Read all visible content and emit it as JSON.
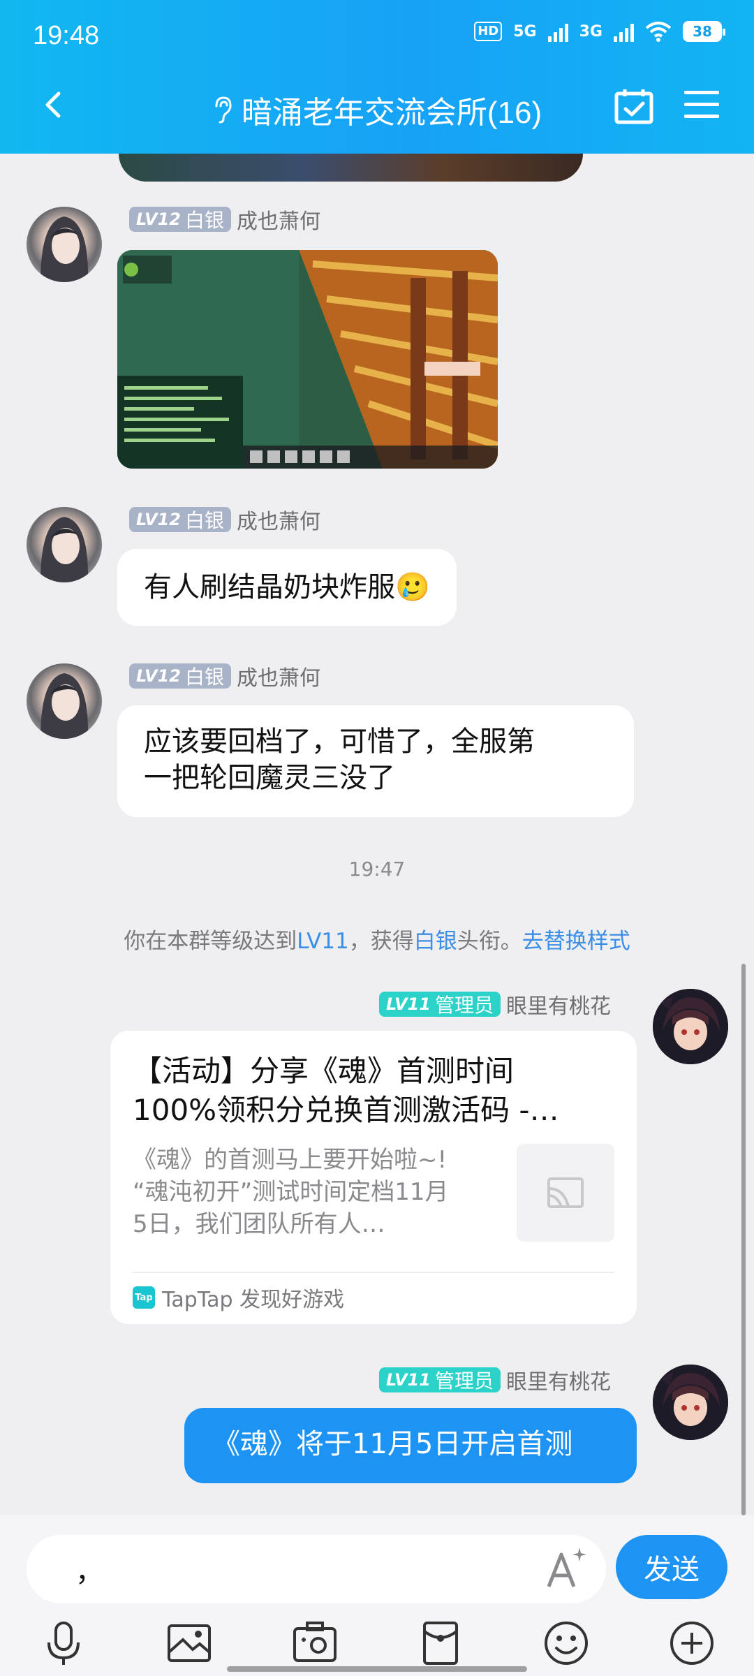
{
  "status_bar": {
    "time": "19:48",
    "hd_label": "HD",
    "net1": "5G",
    "net2": "3G",
    "battery": "38"
  },
  "header": {
    "title": "暗涌老年交流会所(16)"
  },
  "messages": [
    {
      "sender": "成也萧何",
      "badge_level": "LV12",
      "badge_title": "白银",
      "type": "image"
    },
    {
      "sender": "成也萧何",
      "badge_level": "LV12",
      "badge_title": "白银",
      "type": "text",
      "text": "有人刷结晶奶块炸服",
      "emoji": "🥲"
    },
    {
      "sender": "成也萧何",
      "badge_level": "LV12",
      "badge_title": "白银",
      "type": "text",
      "text_line1": "应该要回档了，可惜了，全服第",
      "text_line2": "一把轮回魔灵三没了"
    },
    {
      "sender": "眼里有桃花",
      "badge_level": "LV11",
      "badge_title": "管理员",
      "type": "card",
      "card_title_line1": "【活动】分享《魂》首测时间",
      "card_title_line2": "100%领积分兑换首测激活码 -…",
      "card_desc_line1": "《魂》的首测马上要开始啦~!",
      "card_desc_line2": "“魂沌初开”测试时间定档11月",
      "card_desc_line3": "5日，我们团队所有人…",
      "card_source": "TapTap 发现好游戏",
      "card_source_logo": "Tap"
    },
    {
      "sender": "眼里有桃花",
      "badge_level": "LV11",
      "badge_title": "管理员",
      "type": "text",
      "text": "《魂》将于11月5日开启首测"
    }
  ],
  "timestamp": "19:47",
  "system_message": {
    "part1": "你在本群等级达到",
    "level": "LV11",
    "part2": "，获得",
    "title": "白银",
    "part3": "头衔。",
    "action": "去替换样式"
  },
  "input": {
    "value": "，",
    "send_label": "发送"
  },
  "colors": {
    "header_blue": "#17a2f6",
    "bubble_mine": "#1d93f4",
    "admin_badge": "#2bd2c8",
    "silver_badge": "#a9b3c7",
    "link": "#3a8ee6"
  },
  "icons": {
    "back": "back-icon",
    "ear": "ear-icon",
    "calendar": "calendar-check-icon",
    "menu": "menu-icon",
    "toolbar": [
      "microphone-icon",
      "image-icon",
      "camera-icon",
      "red-packet-icon",
      "emoji-icon",
      "plus-icon"
    ]
  }
}
